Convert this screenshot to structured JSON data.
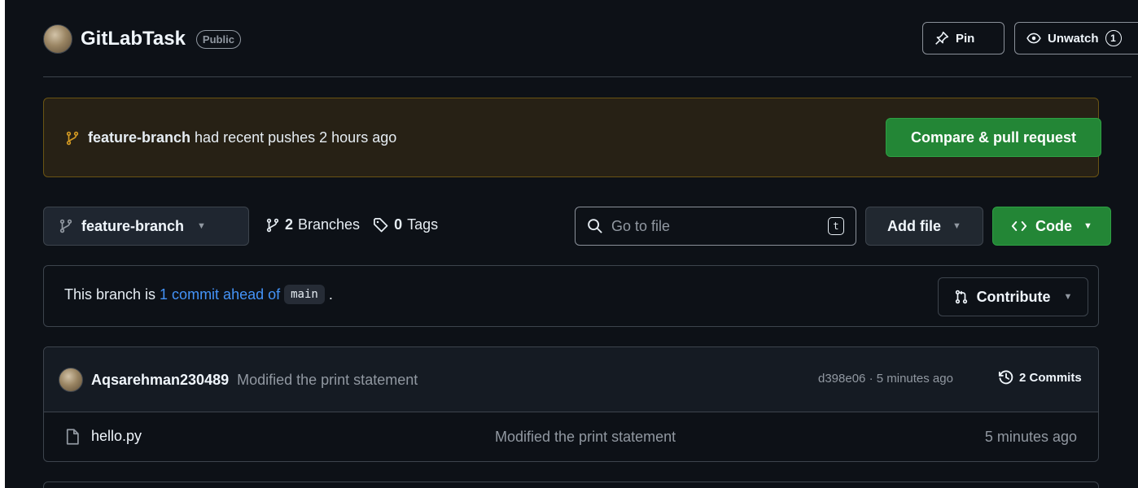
{
  "repo": {
    "name": "GitLabTask",
    "visibility": "Public"
  },
  "header_actions": {
    "pin_label": "Pin",
    "unwatch_label": "Unwatch",
    "watch_count": "1"
  },
  "push_banner": {
    "branch": "feature-branch",
    "message": "had recent pushes 2 hours ago",
    "compare_label": "Compare & pull request"
  },
  "toolbar": {
    "current_branch": "feature-branch",
    "branches_count": "2",
    "branches_label": "Branches",
    "tags_count": "0",
    "tags_label": "Tags",
    "search_placeholder": "Go to file",
    "search_shortcut": "t",
    "add_file_label": "Add file",
    "code_label": "Code"
  },
  "ahead": {
    "prefix": "This branch is",
    "link": "1 commit ahead of",
    "base_branch": "main",
    "suffix": ".",
    "contribute_label": "Contribute"
  },
  "latest_commit": {
    "author": "Aqsarehman230489",
    "message": "Modified the print statement",
    "hash_time": "d398e06 · 5 minutes ago",
    "commits_label": "2 Commits"
  },
  "files": [
    {
      "name": "hello.py",
      "message": "Modified the print statement",
      "time": "5 minutes ago"
    }
  ],
  "colors": {
    "background": "#0d1117",
    "primary_green": "#238636",
    "link_blue": "#4493f8",
    "banner_bg": "#272115",
    "banner_border": "#6a5413",
    "branch_icon_yellow": "#d29922"
  }
}
